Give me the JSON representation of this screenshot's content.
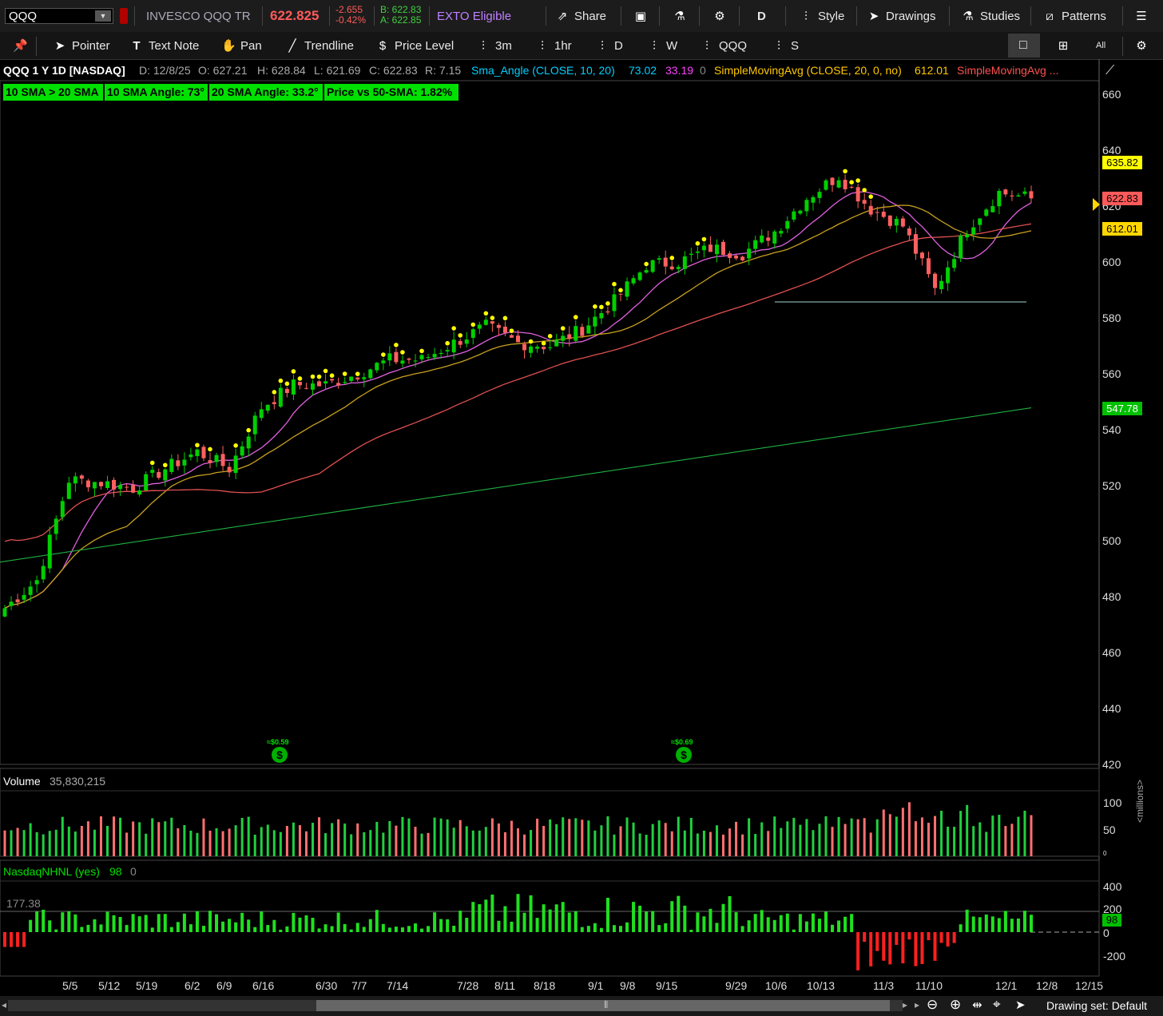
{
  "topbar": {
    "symbol": "QQQ",
    "name": "INVESCO QQQ TR",
    "last": "622.825",
    "change": "-2.655",
    "change_pct": "-0.42%",
    "bid": "B: 622.83",
    "ask": "A: 622.85",
    "exto": "EXTO Eligible",
    "share": "Share",
    "agg": "D",
    "style": "Style",
    "drawings": "Drawings",
    "studies": "Studies",
    "patterns": "Patterns"
  },
  "toolbar": {
    "pointer": "Pointer",
    "text_note": "Text Note",
    "pan": "Pan",
    "trendline": "Trendline",
    "price_level": "Price Level",
    "tf1": "3m",
    "tf2": "1hr",
    "tf3": "D",
    "tf4": "W",
    "tf5": "QQQ",
    "tf6": "S",
    "layout": "All"
  },
  "header": {
    "title": "QQQ 1 Y 1D [NASDAQ]",
    "date": "D: 12/8/25",
    "open": "O: 627.21",
    "high": "H: 628.84",
    "low": "L: 621.69",
    "close": "C: 622.83",
    "range": "R: 7.15",
    "study1": "Sma_Angle (CLOSE, 10, 20)",
    "study1_v1": "73.02",
    "study1_v2": "33.19",
    "study1_v3": "0",
    "study2": "SimpleMovingAvg (CLOSE, 20, 0, no)",
    "study2_v": "612.01",
    "study3": "SimpleMovingAvg ..."
  },
  "badges": [
    "10 SMA > 20 SMA",
    "10 SMA Angle: 73°",
    "20 SMA Angle: 33.2°",
    "Price vs 50-SMA: 1.82%"
  ],
  "dividends": [
    "≈$0.59",
    "≈$0.69"
  ],
  "price_axis": {
    "ticks": [
      "660",
      "640",
      "620",
      "600",
      "580",
      "560",
      "540",
      "520",
      "500",
      "480",
      "460",
      "440",
      "420"
    ],
    "tags": [
      {
        "label": "635.82",
        "value": 635.82,
        "color": "#ffff00",
        "text": "#000"
      },
      {
        "label": "622.83",
        "value": 622.83,
        "color": "#ff5a5a",
        "text": "#000"
      },
      {
        "label": "612.01",
        "value": 612.01,
        "color": "#ffd700",
        "text": "#000"
      },
      {
        "label": "547.78",
        "value": 547.78,
        "color": "#00c000",
        "text": "#fff"
      }
    ]
  },
  "volume": {
    "label": "Volume",
    "value": "35,830,215",
    "ticks": [
      "100",
      "50",
      "0"
    ],
    "unit": "<millions>"
  },
  "nhnl": {
    "label": "NasdaqNHNL (yes)",
    "v1": "98",
    "v2": "0",
    "ref": "177.38",
    "ticks": [
      "400",
      "200",
      "0",
      "-200"
    ],
    "tag": "98"
  },
  "dates": [
    "5/5",
    "5/12",
    "5/19",
    "6/2",
    "6/9",
    "6/16",
    "6/30",
    "7/7",
    "7/14",
    "7/28",
    "8/11",
    "8/18",
    "9/1",
    "9/8",
    "9/15",
    "9/29",
    "10/6",
    "10/13",
    "11/3",
    "11/10",
    "12/1",
    "12/8",
    "12/15"
  ],
  "footer": {
    "drawing_set": "Drawing set: Default"
  },
  "chart_data": {
    "type": "candlestick",
    "title": "QQQ 1 Y 1D [NASDAQ]",
    "ylim": [
      420,
      665
    ],
    "x": [
      "4/28",
      "5/5",
      "5/12",
      "5/19",
      "5/26",
      "6/2",
      "6/9",
      "6/16",
      "6/23",
      "6/30",
      "7/7",
      "7/14",
      "7/21",
      "7/28",
      "8/4",
      "8/11",
      "8/18",
      "8/25",
      "9/1",
      "9/8",
      "9/15",
      "9/22",
      "9/29",
      "10/6",
      "10/13",
      "10/20",
      "10/27",
      "11/3",
      "11/10",
      "11/17",
      "11/24",
      "12/1",
      "12/8"
    ],
    "close_weekly": [
      476,
      486,
      522,
      521,
      519,
      526,
      532,
      526,
      548,
      556,
      556,
      560,
      565,
      565,
      571,
      577,
      571,
      570,
      576,
      586,
      599,
      600,
      605,
      603,
      611,
      623,
      631,
      619,
      613,
      590,
      612,
      625,
      622.83
    ],
    "sma10_last": 622.0,
    "sma20_last": 612.01,
    "sma50_last": 611.0,
    "sma200_last": 547.78
  }
}
